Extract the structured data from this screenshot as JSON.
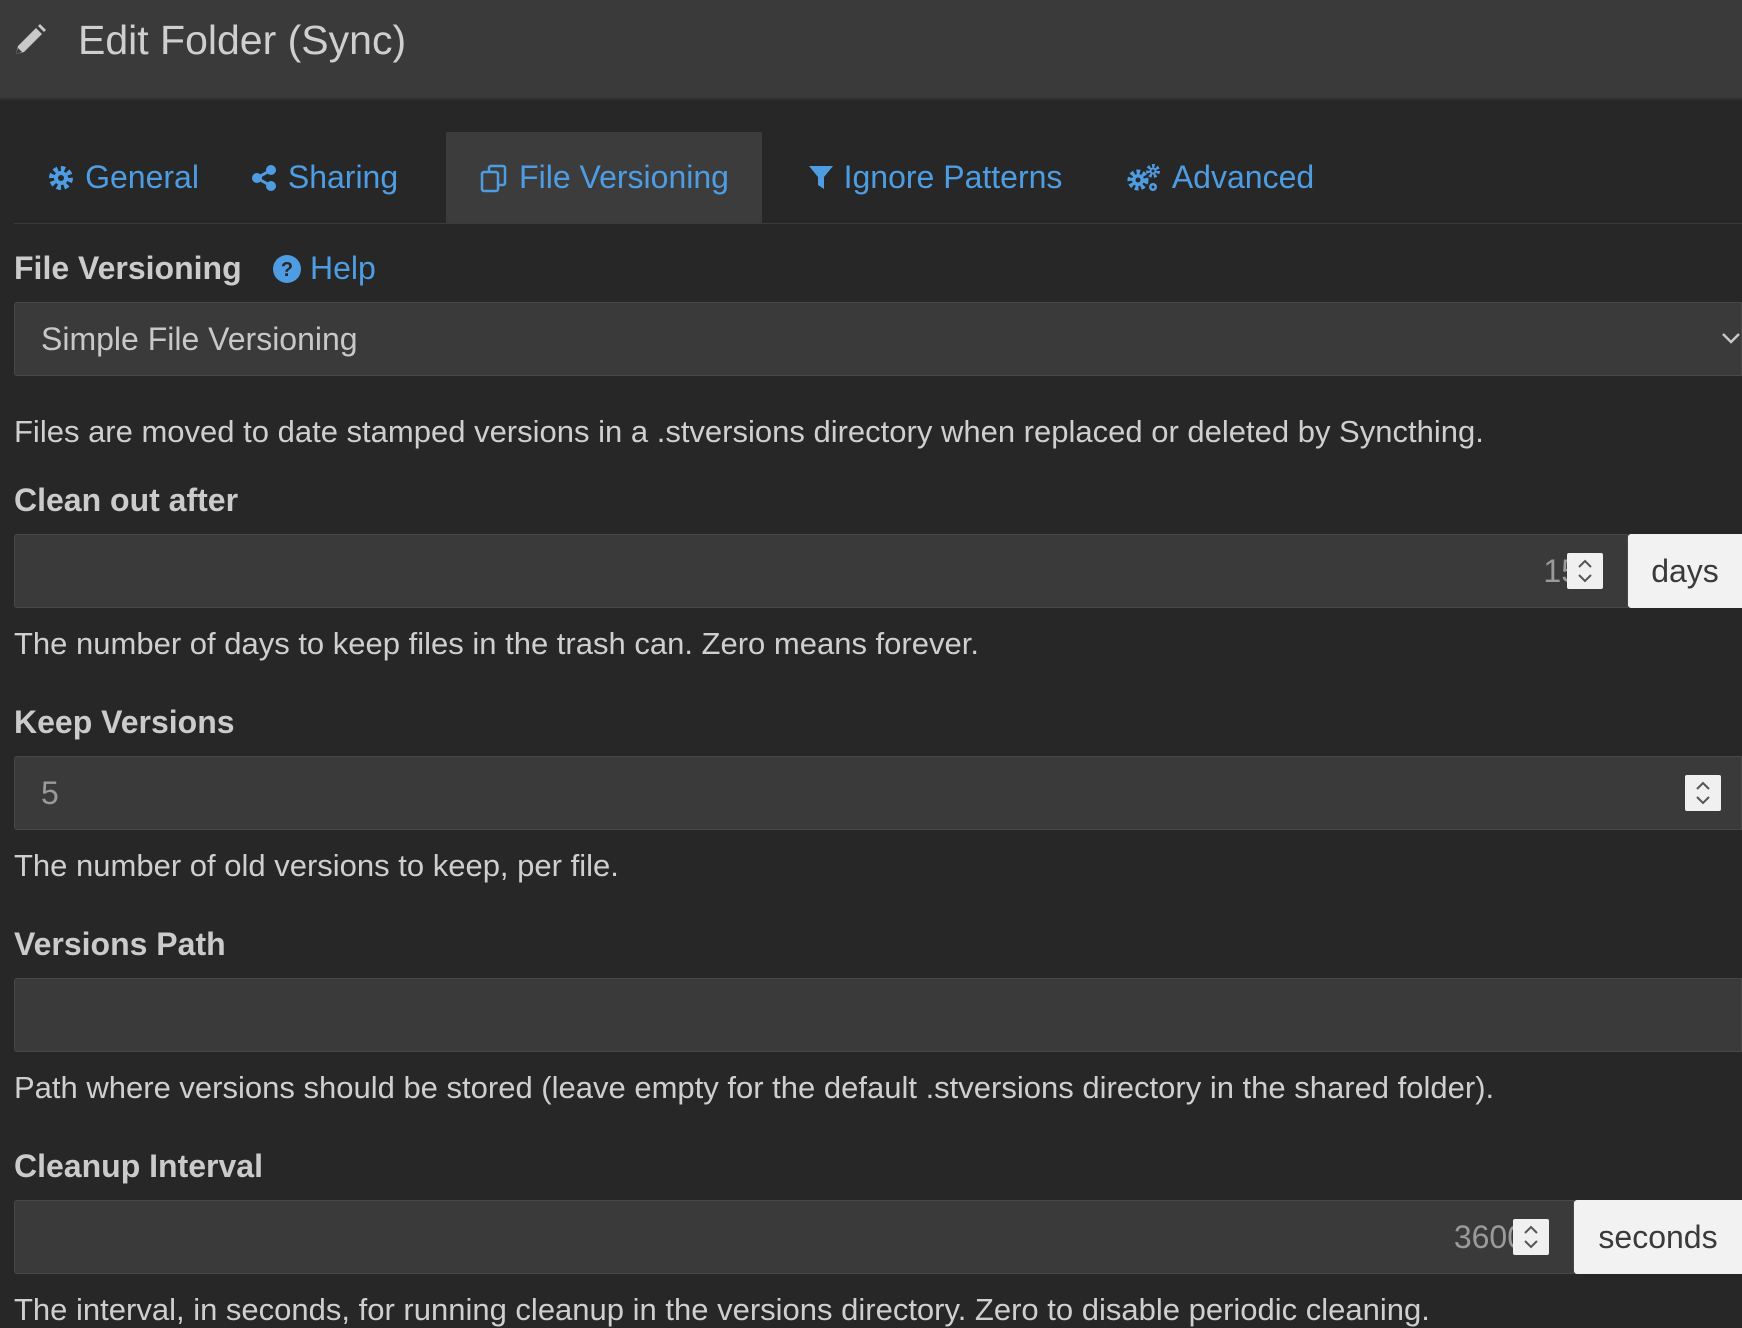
{
  "header": {
    "title": "Edit Folder (Sync)",
    "icon": "pencil-icon"
  },
  "tabs": [
    {
      "label": "General",
      "icon": "gear-icon",
      "active": false
    },
    {
      "label": "Sharing",
      "icon": "share-icon",
      "active": false
    },
    {
      "label": "File Versioning",
      "icon": "copy-icon",
      "active": true
    },
    {
      "label": "Ignore Patterns",
      "icon": "filter-icon",
      "active": false
    },
    {
      "label": "Advanced",
      "icon": "gears-icon",
      "active": false
    }
  ],
  "versioning": {
    "label": "File Versioning",
    "help_label": "Help",
    "selected": "Simple File Versioning",
    "description": "Files are moved to date stamped versions in a .stversions directory when replaced or deleted by Syncthing."
  },
  "clean_out": {
    "label": "Clean out after",
    "value": "15",
    "unit": "days",
    "description": "The number of days to keep files in the trash can. Zero means forever."
  },
  "keep_versions": {
    "label": "Keep Versions",
    "value": "5",
    "description": "The number of old versions to keep, per file."
  },
  "versions_path": {
    "label": "Versions Path",
    "value": "",
    "description": "Path where versions should be stored (leave empty for the default .stversions directory in the shared folder)."
  },
  "cleanup_interval": {
    "label": "Cleanup Interval",
    "value": "3600",
    "unit": "seconds",
    "description": "The interval, in seconds, for running cleanup in the versions directory. Zero to disable periodic cleaning."
  },
  "colors": {
    "background": "#272727",
    "header": "#3a3a3a",
    "link": "#4e9de3",
    "input": "#3a3a3a"
  }
}
